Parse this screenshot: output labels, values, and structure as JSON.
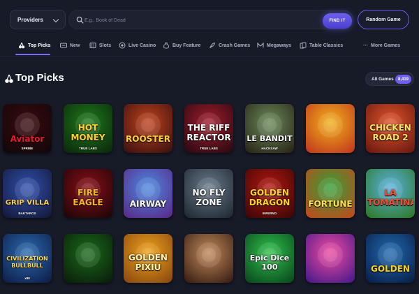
{
  "search": {
    "providers_label": "Providers",
    "placeholder": "E.g., Book of Dead",
    "find_label": "FIND IT",
    "random_label": "Random Game"
  },
  "tabs": [
    {
      "label": "Top Picks",
      "icon": "cherry-icon",
      "active": true
    },
    {
      "label": "New",
      "icon": "new-badge-icon"
    },
    {
      "label": "Slots",
      "icon": "slot-machine-icon"
    },
    {
      "label": "Live Casino",
      "icon": "chip-icon"
    },
    {
      "label": "Buy Feature",
      "icon": "money-bag-icon"
    },
    {
      "label": "Crash Games",
      "icon": "rocket-icon"
    },
    {
      "label": "Megaways",
      "icon": "megaways-icon"
    },
    {
      "label": "Table Classics",
      "icon": "cards-icon"
    }
  ],
  "more_label": "More Games",
  "section": {
    "title": "Top Picks",
    "all_games_label": "All Games",
    "all_games_count": "8,419"
  },
  "games": [
    {
      "t1": "Aviator",
      "t2": "",
      "sub": "SPRIBE",
      "bg1": "#3a0a0e",
      "bg2": "#12070a",
      "color": "#e01c2c"
    },
    {
      "t1": "HOT",
      "t2": "MONEY",
      "sub": "TRUE LABS",
      "bg1": "#1f7a1a",
      "bg2": "#0b2a0c",
      "color": "#ffd21f"
    },
    {
      "t1": "ROOSTER",
      "t2": "",
      "sub": "",
      "bg1": "#c0421c",
      "bg2": "#3d1210",
      "color": "#ffcf3a"
    },
    {
      "t1": "THE RIFF",
      "t2": "REACTOR",
      "sub": "TRUE LABS",
      "bg1": "#a31c2c",
      "bg2": "#2a0a12",
      "color": "#ffffff"
    },
    {
      "t1": "LE BANDIT",
      "t2": "",
      "sub": "HACKSAW",
      "bg1": "#6b8a5a",
      "bg2": "#2a2618",
      "color": "#ffffff"
    },
    {
      "t1": "",
      "t2": "",
      "sub": "",
      "bg1": "#f2b21a",
      "bg2": "#c23a1c",
      "color": "#ffffff"
    },
    {
      "t1": "CHICKEN",
      "t2": "ROAD 2",
      "sub": "",
      "bg1": "#e2532a",
      "bg2": "#6b1a10",
      "color": "#ffe15a"
    },
    {
      "t1": "GRIP VILLA",
      "t2": "",
      "sub": "BAKTAROS",
      "bg1": "#2f4fb0",
      "bg2": "#151a3a",
      "color": "#ffd44a"
    },
    {
      "t1": "FIRE",
      "t2": "EAGLE",
      "sub": "",
      "bg1": "#8a0f16",
      "bg2": "#1f0508",
      "color": "#ffb21f"
    },
    {
      "t1": "AIRWAY",
      "t2": "",
      "sub": "",
      "bg1": "#4a8ae0",
      "bg2": "#5a2a8a",
      "color": "#ffffff"
    },
    {
      "t1": "NO FLY",
      "t2": "ZONE",
      "sub": "",
      "bg1": "#6a7a8a",
      "bg2": "#1f2a33",
      "color": "#ffffff"
    },
    {
      "t1": "GOLDEN",
      "t2": "DRAGON",
      "sub": "INFERNO",
      "bg1": "#b3170f",
      "bg2": "#3f0707",
      "color": "#ffd21f"
    },
    {
      "t1": "FORTUNE",
      "t2": "",
      "sub": "",
      "bg1": "#2fa036",
      "bg2": "#c24a1c",
      "color": "#ffe04a"
    },
    {
      "t1": "LA",
      "t2": "TOMATINA",
      "sub": "",
      "bg1": "#58b2e0",
      "bg2": "#2f7a2a",
      "color": "#ff4a2a"
    },
    {
      "t1": "CIVILIZATION",
      "t2": "BULLBULL",
      "sub": "x88",
      "bg1": "#2a6ab0",
      "bg2": "#0f1f4a",
      "color": "#ffd84a"
    },
    {
      "t1": "",
      "t2": "",
      "sub": "",
      "bg1": "#1a6a1a",
      "bg2": "#0a1f0a",
      "color": "#ffd21f"
    },
    {
      "t1": "GOLDEN",
      "t2": "PIXIU",
      "sub": "",
      "bg1": "#f0a21a",
      "bg2": "#8a4a10",
      "color": "#fff3b0"
    },
    {
      "t1": "",
      "t2": "",
      "sub": "",
      "bg1": "#c08a5a",
      "bg2": "#3a1f14",
      "color": "#ffffff"
    },
    {
      "t1": "Epic Dice",
      "t2": "100",
      "sub": "",
      "bg1": "#2fc04a",
      "bg2": "#0a4a1f",
      "color": "#ffffff"
    },
    {
      "t1": "",
      "t2": "",
      "sub": "",
      "bg1": "#f04aa0",
      "bg2": "#4a1a8a",
      "color": "#ffffff"
    },
    {
      "t1": "GOLDEN",
      "t2": "",
      "sub": "",
      "bg1": "#1f6ab0",
      "bg2": "#0a1f4a",
      "color": "#ffd21f"
    }
  ]
}
